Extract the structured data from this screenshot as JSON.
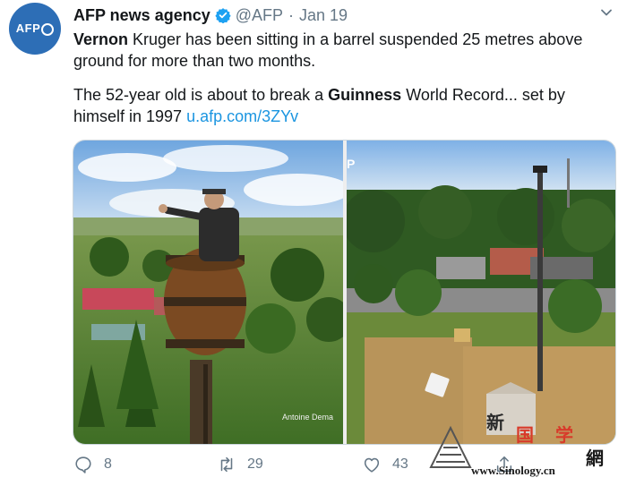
{
  "tweet": {
    "author_name": "AFP news agency",
    "handle": "@AFP",
    "separator": "·",
    "date": "Jan 19",
    "paragraph1": {
      "bold_lead": "Vernon",
      "rest": " Kruger has been sitting in a barrel suspended 25 metres above ground for more than two months."
    },
    "paragraph2": {
      "part1": "The 52-year old is about to break a ",
      "bold": "Guinness",
      "part2": " World Record... set by himself in 1997 ",
      "link": "u.afp.com/3ZYv"
    },
    "avatar_text": "AFP",
    "media": {
      "left_photo_credit": "Antoine Dema",
      "right_photo_mark": "P"
    },
    "actions": {
      "reply_count": "8",
      "retweet_count": "29",
      "like_count": "43"
    }
  },
  "watermark": {
    "char1": "新",
    "char2": "国",
    "char3": "学",
    "char4": "網",
    "site": "www.Sinology.cn"
  },
  "colors": {
    "link": "#1b95e0",
    "verified": "#1da1f2",
    "avatar_bg": "#2d6eb6",
    "muted": "#657786"
  },
  "icons": [
    "verified-badge-icon",
    "chevron-down-icon",
    "reply-icon",
    "retweet-icon",
    "heart-icon",
    "share-icon"
  ]
}
